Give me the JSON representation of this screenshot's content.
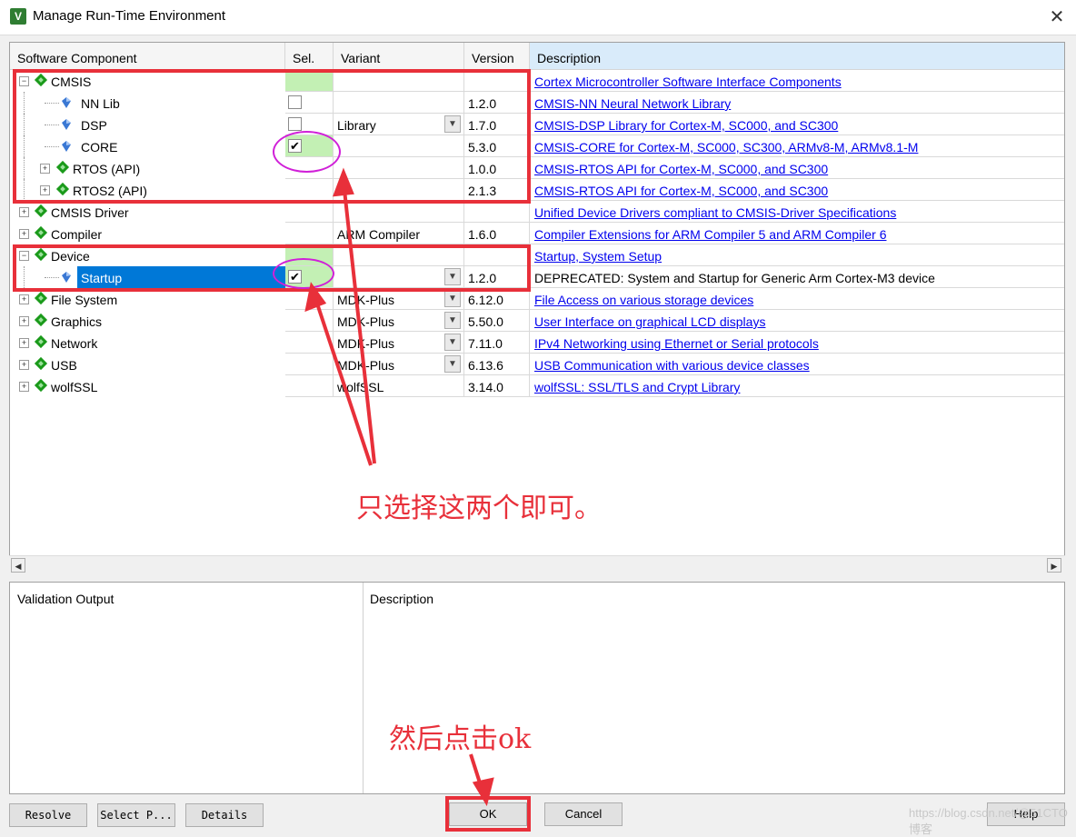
{
  "window": {
    "title": "Manage Run-Time Environment",
    "close_glyph": "✕"
  },
  "columns": {
    "component": "Software Component",
    "sel": "Sel.",
    "variant": "Variant",
    "version": "Version",
    "description": "Description"
  },
  "rows": [
    {
      "name": "CMSIS",
      "variant": "",
      "version": "",
      "description": "Cortex Microcontroller Software Interface Components",
      "link": true
    },
    {
      "name": "NN Lib",
      "variant": "",
      "version": "1.2.0",
      "description": "CMSIS-NN Neural Network Library",
      "link": true
    },
    {
      "name": "DSP",
      "variant": "Library",
      "version": "1.7.0",
      "description": "CMSIS-DSP Library for Cortex-M, SC000, and SC300",
      "link": true
    },
    {
      "name": "CORE",
      "variant": "",
      "version": "5.3.0",
      "description": "CMSIS-CORE for Cortex-M, SC000, SC300, ARMv8-M, ARMv8.1-M",
      "link": true
    },
    {
      "name": "RTOS (API)",
      "variant": "",
      "version": "1.0.0",
      "description": "CMSIS-RTOS API for Cortex-M, SC000, and SC300",
      "link": true
    },
    {
      "name": "RTOS2 (API)",
      "variant": "",
      "version": "2.1.3",
      "description": "CMSIS-RTOS API for Cortex-M, SC000, and SC300",
      "link": true
    },
    {
      "name": "CMSIS Driver",
      "variant": "",
      "version": "",
      "description": "Unified Device Drivers compliant to CMSIS-Driver Specifications",
      "link": true
    },
    {
      "name": "Compiler",
      "variant": "ARM Compiler",
      "version": "1.6.0",
      "description": "Compiler Extensions for ARM Compiler 5 and ARM Compiler 6",
      "link": true
    },
    {
      "name": "Device",
      "variant": "",
      "version": "",
      "description": "Startup, System Setup",
      "link": true
    },
    {
      "name": "Startup",
      "variant": "",
      "version": "1.2.0",
      "description": "DEPRECATED: System and Startup for Generic Arm Cortex-M3 device",
      "link": false
    },
    {
      "name": "File System",
      "variant": "MDK-Plus",
      "version": "6.12.0",
      "description": "File Access on various storage devices",
      "link": true
    },
    {
      "name": "Graphics",
      "variant": "MDK-Plus",
      "version": "5.50.0",
      "description": "User Interface on graphical LCD displays",
      "link": true
    },
    {
      "name": "Network",
      "variant": "MDK-Plus",
      "version": "7.11.0",
      "description": "IPv4 Networking using Ethernet or Serial protocols",
      "link": true
    },
    {
      "name": "USB",
      "variant": "MDK-Plus",
      "version": "6.13.6",
      "description": "USB Communication with various device classes",
      "link": true
    },
    {
      "name": "wolfSSL",
      "variant": "wolfSSL",
      "version": "3.14.0",
      "description": "wolfSSL: SSL/TLS and Crypt Library",
      "link": true
    }
  ],
  "checkmark": "✔",
  "expand_glyphs": {
    "expanded": "−",
    "collapsed": "+"
  },
  "dropdown_glyph": "▼",
  "scroll_glyphs": {
    "left": "◀",
    "right": "▶"
  },
  "bottom": {
    "validation_output": "Validation Output",
    "description": "Description"
  },
  "buttons": {
    "resolve": "Resolve",
    "select_packs": "Select P...",
    "details": "Details",
    "ok": "OK",
    "cancel": "Cancel",
    "help": "Help"
  },
  "annotations": {
    "select_note": "只选择这两个即可。",
    "click_note": "然后点击ok"
  },
  "watermark": "https://blog.csdn.net/@51CTO博客",
  "colors": {
    "link": "#0000ee",
    "selected_row": "#0078d7",
    "selection_green": "#c3f0b4",
    "annotation_red": "#e8303a",
    "annotation_magenta": "#d020d8",
    "gem_green": "#1a9a1a"
  }
}
